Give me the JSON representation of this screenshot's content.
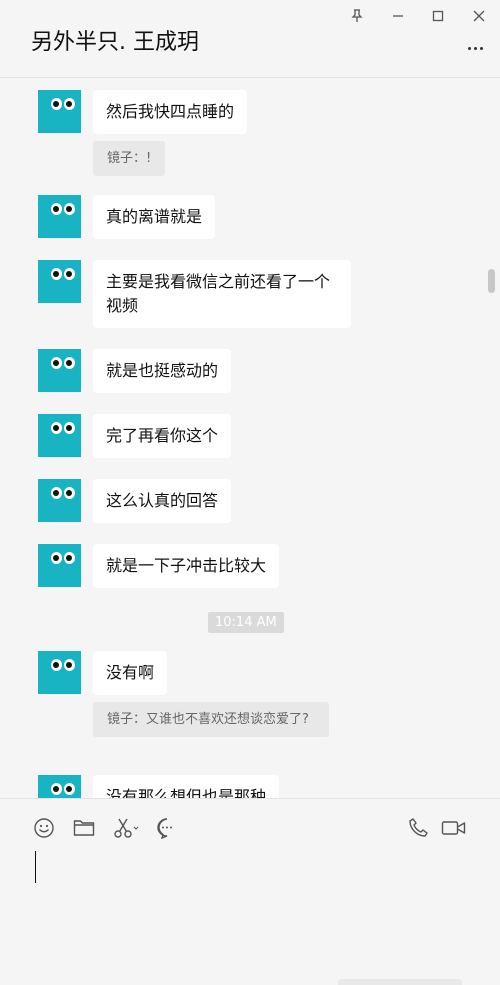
{
  "window": {
    "title": "另外半只. 王成玥"
  },
  "messages": [
    {
      "text": "然后我快四点睡的"
    },
    {
      "quote": "镜子：!"
    },
    {
      "text": "真的离谱就是"
    },
    {
      "text": "主要是我看微信之前还看了一个视频"
    },
    {
      "text": "就是也挺感动的"
    },
    {
      "text": "完了再看你这个"
    },
    {
      "text": "这么认真的回答"
    },
    {
      "text": "就是一下子冲击比较大"
    },
    {
      "timestamp": "10:14 AM"
    },
    {
      "text": "没有啊"
    },
    {
      "quote": "镜子：又谁也不喜欢还想谈恋爱了?"
    },
    {
      "text": "没有那么想但也是那种"
    }
  ],
  "toolbar": {
    "icons": [
      "emoji-icon",
      "folder-icon",
      "scissors-icon",
      "chat-history-icon",
      "phone-icon",
      "video-icon"
    ]
  },
  "input": {
    "value": ""
  },
  "colors": {
    "avatar": "#19b4c4",
    "background": "#f5f5f5",
    "bubble": "#ffffff",
    "quote_bg": "#e8e8e8"
  }
}
